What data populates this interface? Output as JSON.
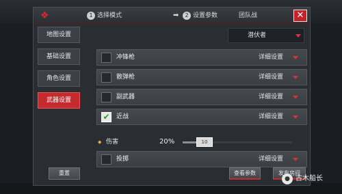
{
  "dialog": {
    "steps": [
      {
        "num": "1",
        "label": "选择模式"
      },
      {
        "num": "2",
        "label": "设置参数"
      }
    ],
    "mode": "团队战",
    "close": "✕"
  },
  "sidebar": {
    "items": [
      {
        "label": "地图设置",
        "active": false
      },
      {
        "label": "基础设置",
        "active": false
      },
      {
        "label": "角色设置",
        "active": false
      },
      {
        "label": "武器设置",
        "active": true
      }
    ]
  },
  "faction": {
    "selected": "潜伏者"
  },
  "weapons": [
    {
      "name": "冲锋枪",
      "checked": false,
      "detail": "详细设置"
    },
    {
      "name": "散弹枪",
      "checked": false,
      "detail": "详细设置"
    },
    {
      "name": "副武器",
      "checked": false,
      "detail": "详细设置"
    },
    {
      "name": "近战",
      "checked": true,
      "detail": "详细设置"
    },
    {
      "name": "投掷",
      "checked": false,
      "detail": "详细设置"
    }
  ],
  "damage": {
    "label": "伤害",
    "value": "20%",
    "fraction": 0.2,
    "knob_text": "10"
  },
  "buttons": {
    "reset": "重置",
    "view_params": "查看参数",
    "publish": "发布房间"
  },
  "watermark": {
    "text": "古木船长"
  },
  "colors": {
    "accent_red": "#c42a2e",
    "check_green": "#2c9a34"
  }
}
